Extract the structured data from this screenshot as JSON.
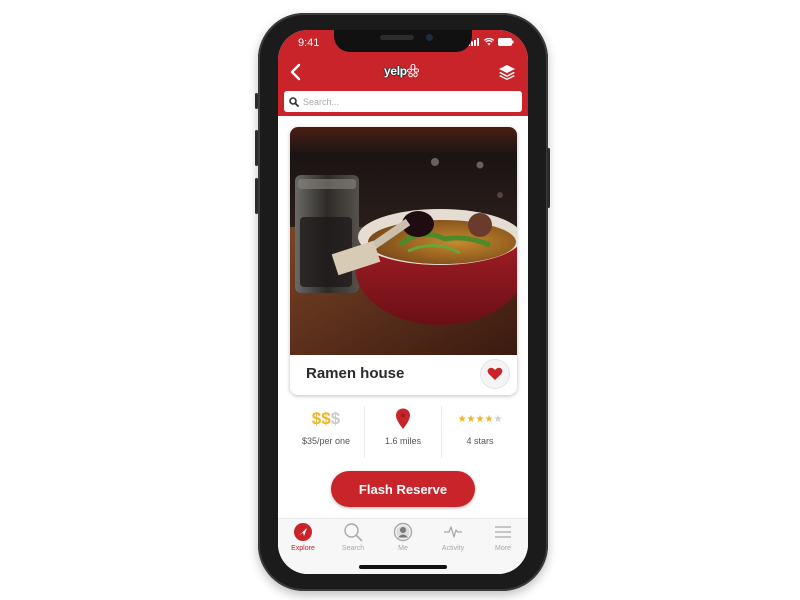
{
  "status_bar": {
    "time": "9:41"
  },
  "header": {
    "logo_text": "yelp",
    "search": {
      "placeholder": "Search...",
      "value": ""
    }
  },
  "listing": {
    "name": "Ramen house",
    "image_alt": "Bowl of ramen with ladle and glass jar",
    "favorited": true,
    "price": {
      "symbols_filled": 2,
      "symbols_total": 3,
      "label": "$35/per one"
    },
    "distance": {
      "label": "1.6 miles"
    },
    "rating": {
      "value": 4,
      "max": 5,
      "label": "4 stars"
    }
  },
  "cta": {
    "label": "Flash Reserve"
  },
  "tabbar": {
    "items": [
      {
        "label": "Explore",
        "icon": "compass-icon",
        "active": true
      },
      {
        "label": "Search",
        "icon": "search-icon",
        "active": false
      },
      {
        "label": "Me",
        "icon": "profile-icon",
        "active": false
      },
      {
        "label": "Activity",
        "icon": "activity-icon",
        "active": false
      },
      {
        "label": "More",
        "icon": "menu-icon",
        "active": false
      }
    ]
  },
  "colors": {
    "brand": "#c8242a",
    "gold": "#f0b429",
    "inactive": "#a8a8a8"
  }
}
